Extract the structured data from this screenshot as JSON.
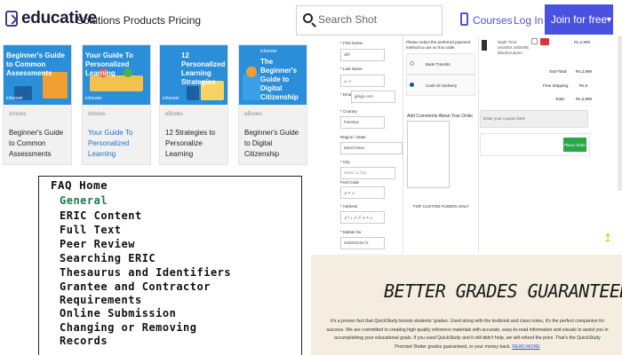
{
  "header": {
    "brand": "educative",
    "nav": "Solutions Products Pricing",
    "search_placeholder": "Search Shot",
    "courses_label": "Courses",
    "login_label": "Log In",
    "join_label": "Join for free",
    "accent_color": "#4951e0"
  },
  "cards": [
    {
      "image_title": "Beginner's Guide to Common Assessments",
      "image_brand": "ichooser",
      "category": "Articles",
      "title": "Beginner's Guide to Common Assessments",
      "color": "#2a8ed8"
    },
    {
      "image_title": "Your Guide To Personalized Learning",
      "image_brand": "ichooser",
      "category": "Articles",
      "title": "Your Guide To Personalized Learning",
      "color": "#2a8ed8"
    },
    {
      "image_title": "12 Personalized Learning Strategies",
      "image_brand": "ichooser",
      "category": "eBooks",
      "title": "12 Strategies to Personalize Learning",
      "color": "#2a8ed8"
    },
    {
      "image_title": "The Beginner's Guide to Digital Citizenship",
      "image_brand": "ichooser",
      "category": "eBooks",
      "title": "Beginner's Guide to Digital Citizenship",
      "color": "#2a8ed8"
    }
  ],
  "faq": {
    "home": "FAQ Home",
    "items": [
      "General",
      "ERIC Content",
      "Full Text",
      "Peer Review",
      "Searching ERIC",
      "Thesaurus and Identifiers",
      "Grantee and Contractor",
      "Requirements",
      "Online Submission",
      "Changing or Removing",
      "Records"
    ],
    "highlight_color": "#1a7a4a"
  },
  "checkout": {
    "fields": [
      {
        "label": "* First Name",
        "value": "Jiffi"
      },
      {
        "label": "* Last Name",
        "value": "ب ن"
      },
      {
        "label": "* Email",
        "value": "jjdsjjs.com"
      },
      {
        "label": "* Country",
        "value": "Pakistan"
      },
      {
        "label": "Region / State",
        "value": "Balochistan"
      },
      {
        "label": "* City",
        "value": "Select a City"
      },
      {
        "label": "Post Code",
        "value": "ن ہ ی"
      },
      {
        "label": "* Address",
        "value": "ن ہ ی ک ل ر ا ی"
      },
      {
        "label": "* Mobile No",
        "value": "03482819473"
      }
    ],
    "payment_prompt": "Please select the preferred payment method to use on this order.",
    "payment_options": [
      "Bank Transfer",
      "Cash On Delivery"
    ],
    "comments_label": "Add Comments About Your Order",
    "coupon_line": "FOR CUSTOM FUSERS ONLY",
    "product": "Night Time UNISEX 400GRE Black/Autumn",
    "product_price": "Rs.2,999",
    "subtotal_label": "Sub-Total:",
    "subtotal_value": "Rs.2,999",
    "shipping_label": "Free Shipping:",
    "shipping_value": "Rs.0",
    "total_label": "Total:",
    "total_value": "Rs.2,999",
    "coupon_placeholder": "Enter your coupon here",
    "place_order_label": "Place Order"
  },
  "promo": {
    "heading": "BETTER GRADES GUARANTEED",
    "body": "It's a proven fact that QuickStudy boosts students' grades. Used along with the textbook and class notes, it's the perfect companion for success. We are committed to creating high quality reference materials with accurate, easy-to-read information and visuals to assist you in accomplishing your educational goals. If you used QuickStudy and it still didn't help, we will refund the price. That's the QuickStudy Promise! Better grades guaranteed, or your money back.",
    "read_more": "READ MORE"
  }
}
